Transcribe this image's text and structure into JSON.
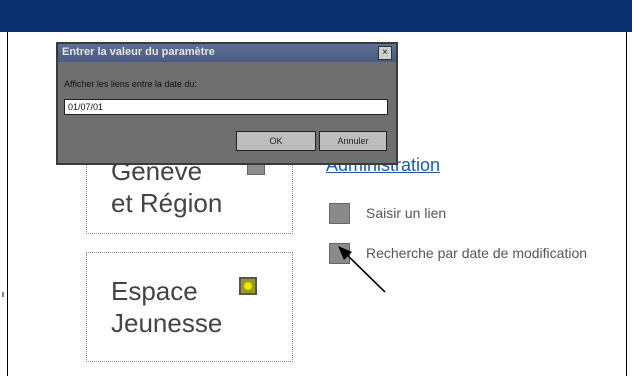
{
  "dialog": {
    "title": "Entrer la valeur du paramètre",
    "close_glyph": "×",
    "prompt": "Afficher les liens entre la date du:",
    "input_value": "01/07/01",
    "ok_label": "OK",
    "cancel_label": "Annuler"
  },
  "tiles": [
    {
      "title": "Genève\net Région",
      "icon": "gray-square-icon"
    },
    {
      "title": "Espace\nJeunesse",
      "icon": "smiley-icon"
    }
  ],
  "admin": {
    "link": "Administration",
    "items": [
      {
        "label": "Saisir un lien",
        "icon": "gray-square-icon"
      },
      {
        "label": "Recherche par date de modification",
        "icon": "gray-square-icon"
      }
    ]
  },
  "colors": {
    "topbar": "#0b2f6e",
    "link": "#1c5aa6",
    "dialog_bg": "#6f6f6f"
  }
}
